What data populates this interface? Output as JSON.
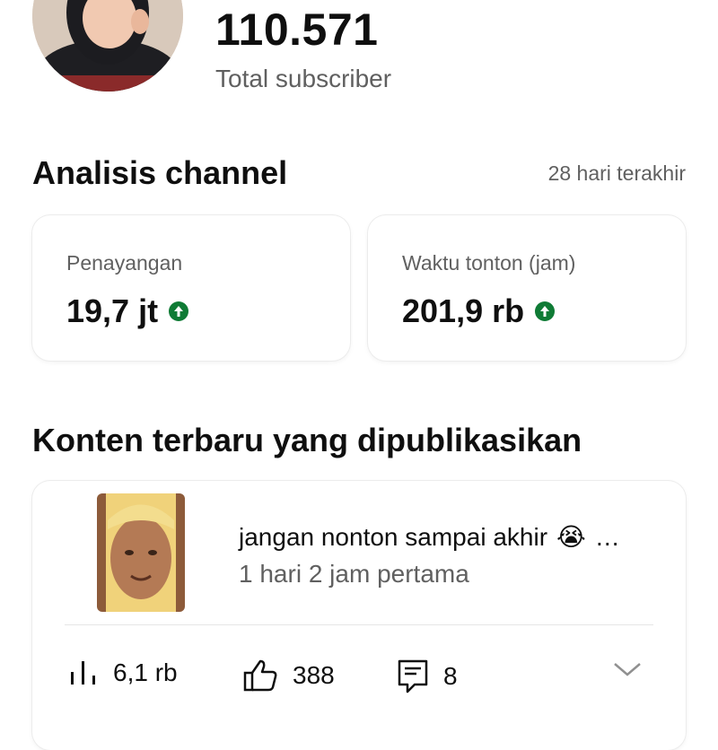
{
  "header": {
    "subscriber_count": "110.571",
    "subscriber_label": "Total subscriber"
  },
  "analytics": {
    "title": "Analisis channel",
    "range": "28 hari terakhir",
    "metrics": [
      {
        "label": "Penayangan",
        "value": "19,7 jt",
        "trend": "up"
      },
      {
        "label": "Waktu tonton (jam)",
        "value": "201,9 rb",
        "trend": "up"
      }
    ]
  },
  "latest": {
    "title": "Konten terbaru yang dipublikasikan",
    "video": {
      "title": "jangan nonton sampai akhir",
      "emoji": "😭",
      "ellipsis": "…",
      "time": "1 hari 2 jam pertama",
      "views": "6,1 rb",
      "likes": "388",
      "comments": "8"
    }
  },
  "colors": {
    "accent_up": "#0f7b35",
    "muted": "#606060"
  }
}
